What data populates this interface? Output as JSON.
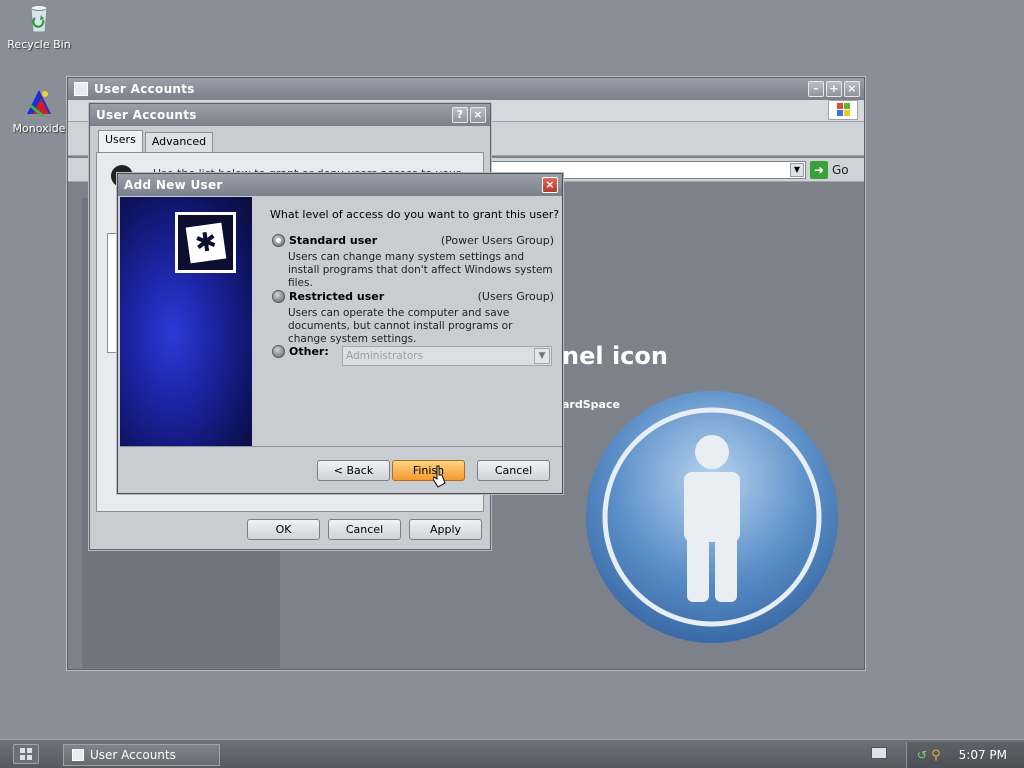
{
  "desktop": {
    "icons": [
      {
        "label": "Recycle Bin",
        "icon": "recycle-bin-icon"
      },
      {
        "label": "Monoxide",
        "icon": "monoxide-icon"
      }
    ]
  },
  "control_panel_window": {
    "title": "User Accounts",
    "address_go_label": "Go",
    "heading_partial": "nel icon",
    "subline_partial": "ardSpace"
  },
  "user_accounts_dialog": {
    "title": "User Accounts",
    "tabs": [
      {
        "label": "Users"
      },
      {
        "label": "Advanced"
      }
    ],
    "hint_partial": "Use the list below to grant or deny users access to your",
    "buttons": {
      "ok": "OK",
      "cancel": "Cancel",
      "apply": "Apply"
    }
  },
  "add_new_user_dialog": {
    "title": "Add New User",
    "question": "What level of access do you want to grant this user?",
    "options": [
      {
        "label": "Standard user",
        "group": "(Power Users Group)",
        "description": "Users can change many system settings and install programs that don't affect Windows system files.",
        "selected": true
      },
      {
        "label": "Restricted user",
        "group": "(Users Group)",
        "description": "Users can operate the computer and save documents, but cannot install programs or change system settings.",
        "selected": false
      },
      {
        "label": "Other:",
        "group": "",
        "description": "",
        "selected": false
      }
    ],
    "other_dropdown_value": "Administrators",
    "buttons": {
      "back": "< Back",
      "finish": "Finish",
      "cancel": "Cancel"
    }
  },
  "taskbar": {
    "task_label": "User Accounts",
    "clock": "5:07 PM"
  },
  "colors": {
    "desktop_bg": "#8a8f97",
    "finish_button": "#f39a2c",
    "wizard_side_panel": "#1d25a6",
    "person_circle": "#5b8fc8"
  }
}
